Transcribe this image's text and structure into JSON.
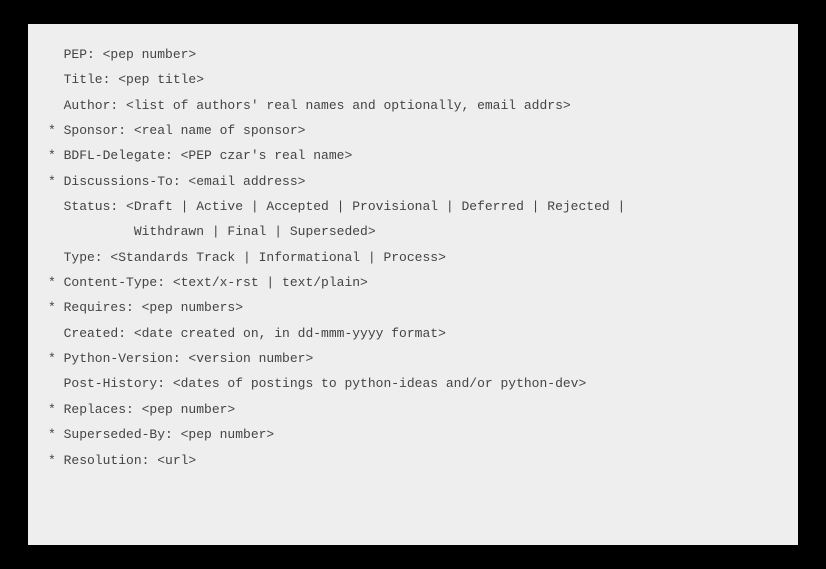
{
  "lines": [
    "  PEP: <pep number>",
    "  Title: <pep title>",
    "  Author: <list of authors' real names and optionally, email addrs>",
    "* Sponsor: <real name of sponsor>",
    "* BDFL-Delegate: <PEP czar's real name>",
    "* Discussions-To: <email address>",
    "  Status: <Draft | Active | Accepted | Provisional | Deferred | Rejected |",
    "           Withdrawn | Final | Superseded>",
    "  Type: <Standards Track | Informational | Process>",
    "* Content-Type: <text/x-rst | text/plain>",
    "* Requires: <pep numbers>",
    "  Created: <date created on, in dd-mmm-yyyy format>",
    "* Python-Version: <version number>",
    "  Post-History: <dates of postings to python-ideas and/or python-dev>",
    "* Replaces: <pep number>",
    "* Superseded-By: <pep number>",
    "* Resolution: <url>"
  ]
}
